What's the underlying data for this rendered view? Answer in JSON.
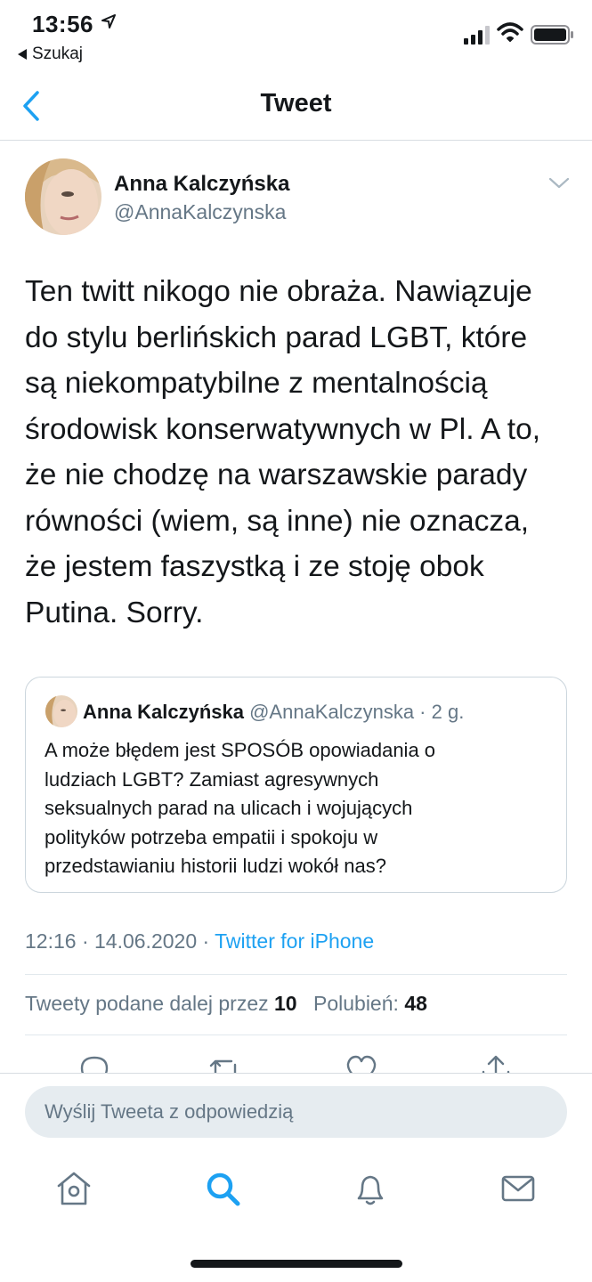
{
  "status_bar": {
    "time": "13:56",
    "back_app_label": "Szukaj",
    "icons": [
      "location-arrow-icon",
      "cellular-signal-icon",
      "wifi-icon",
      "battery-icon"
    ]
  },
  "nav": {
    "title": "Tweet",
    "back_icon": "chevron-left-icon"
  },
  "tweet": {
    "author_name": "Anna Kalczyńska",
    "author_handle": "@AnnaKalczynska",
    "text_lines": [
      "Ten twitt nikogo nie obraża. Nawiązuje",
      "do stylu berlińskich parad LGBT, które",
      "są niekompatybilne z mentalnością",
      "środowisk konserwatywnych w Pl. A to,",
      "że nie chodzę na warszawskie parady",
      "równości (wiem, są inne) nie oznacza,",
      "że jestem faszystką i ze stoję obok",
      "Putina. Sorry."
    ],
    "time": "12:16 · 14.06.2020 · ",
    "source": "Twitter for iPhone",
    "retweets_label": "Tweety podane dalej przez",
    "retweets_count": "10",
    "likes_label": "Polubień:",
    "likes_count": "48"
  },
  "quoted_tweet": {
    "author_name": "Anna Kalczyńska",
    "author_handle_time": "@AnnaKalczynska · 2 g.",
    "text_lines": [
      "A może błędem jest SPOSÓB opowiadania o",
      "ludziach LGBT? Zamiast agresywnych",
      "seksualnych parad na ulicach i wojujących",
      "polityków potrzeba empatii i spokoju w",
      "przedstawianiu historii ludzi wokół nas?"
    ]
  },
  "actions": [
    "reply-icon",
    "retweet-icon",
    "like-icon",
    "share-icon"
  ],
  "reply": {
    "placeholder": "Wyślij Tweeta z odpowiedzią"
  },
  "tab_bar": [
    "home-icon",
    "search-icon",
    "notifications-icon",
    "messages-icon"
  ],
  "colors": {
    "accent": "#1da1f2",
    "secondary_text": "#657786",
    "primary_text": "#14171a",
    "border": "#ccd6dd"
  }
}
